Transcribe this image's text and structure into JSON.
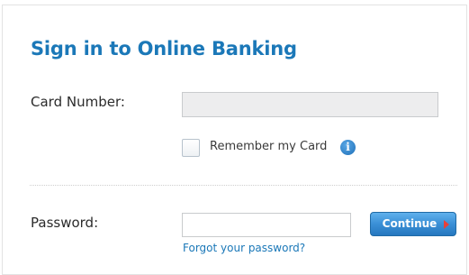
{
  "login": {
    "title": "Sign in to Online Banking",
    "card_number_label": "Card Number:",
    "card_number_value": "",
    "remember_label": "Remember my Card",
    "remember_checked": false,
    "info_icon": "i",
    "password_label": "Password:",
    "password_value": "",
    "continue_label": "Continue",
    "forgot_link": "Forgot your password?"
  },
  "icons": {
    "info": "info-icon",
    "continue_arrow": "arrow-right-icon"
  },
  "colors": {
    "title": "#1b78b8",
    "link": "#1b78b8",
    "button": "#3a8fd6",
    "button_arrow": "#e8403a",
    "card_input_bg": "#ededee"
  }
}
